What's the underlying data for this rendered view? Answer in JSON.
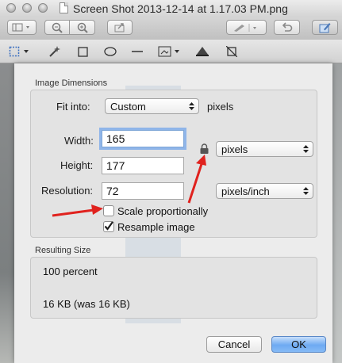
{
  "window": {
    "title": "Screen Shot 2013-12-14 at 1.17.03 PM.png"
  },
  "toolbar": {
    "icons": [
      "sidebar-icon",
      "zoom-out-icon",
      "zoom-in-icon",
      "share-icon",
      "annotate-pen-icon",
      "rotate-icon",
      "edit-toolbar-icon"
    ]
  },
  "editbar": {
    "icons": [
      "rect-selection-icon",
      "magic-wand-icon",
      "rectangle-icon",
      "oval-icon",
      "line-icon",
      "adjust-size-icon",
      "adjust-color-icon",
      "crop-icon"
    ]
  },
  "dialog": {
    "image_dimensions": {
      "section_title": "Image Dimensions",
      "fit_into_label": "Fit into:",
      "fit_into_value": "Custom",
      "fit_into_unit": "pixels",
      "width_label": "Width:",
      "width_value": "165",
      "height_label": "Height:",
      "height_value": "177",
      "resolution_label": "Resolution:",
      "resolution_value": "72",
      "size_unit": "pixels",
      "resolution_unit": "pixels/inch",
      "scale_label": "Scale proportionally",
      "scale_checked": false,
      "resample_label": "Resample image",
      "resample_checked": true
    },
    "resulting_size": {
      "section_title": "Resulting Size",
      "percent": "100 percent",
      "size": "16 KB (was 16 KB)"
    },
    "buttons": {
      "cancel": "Cancel",
      "ok": "OK"
    }
  },
  "annotations": {
    "arrow_color": "#e0221e"
  },
  "colors": {
    "focus_ring": "#73a5eb",
    "ok_button": "#6eaaf2"
  }
}
